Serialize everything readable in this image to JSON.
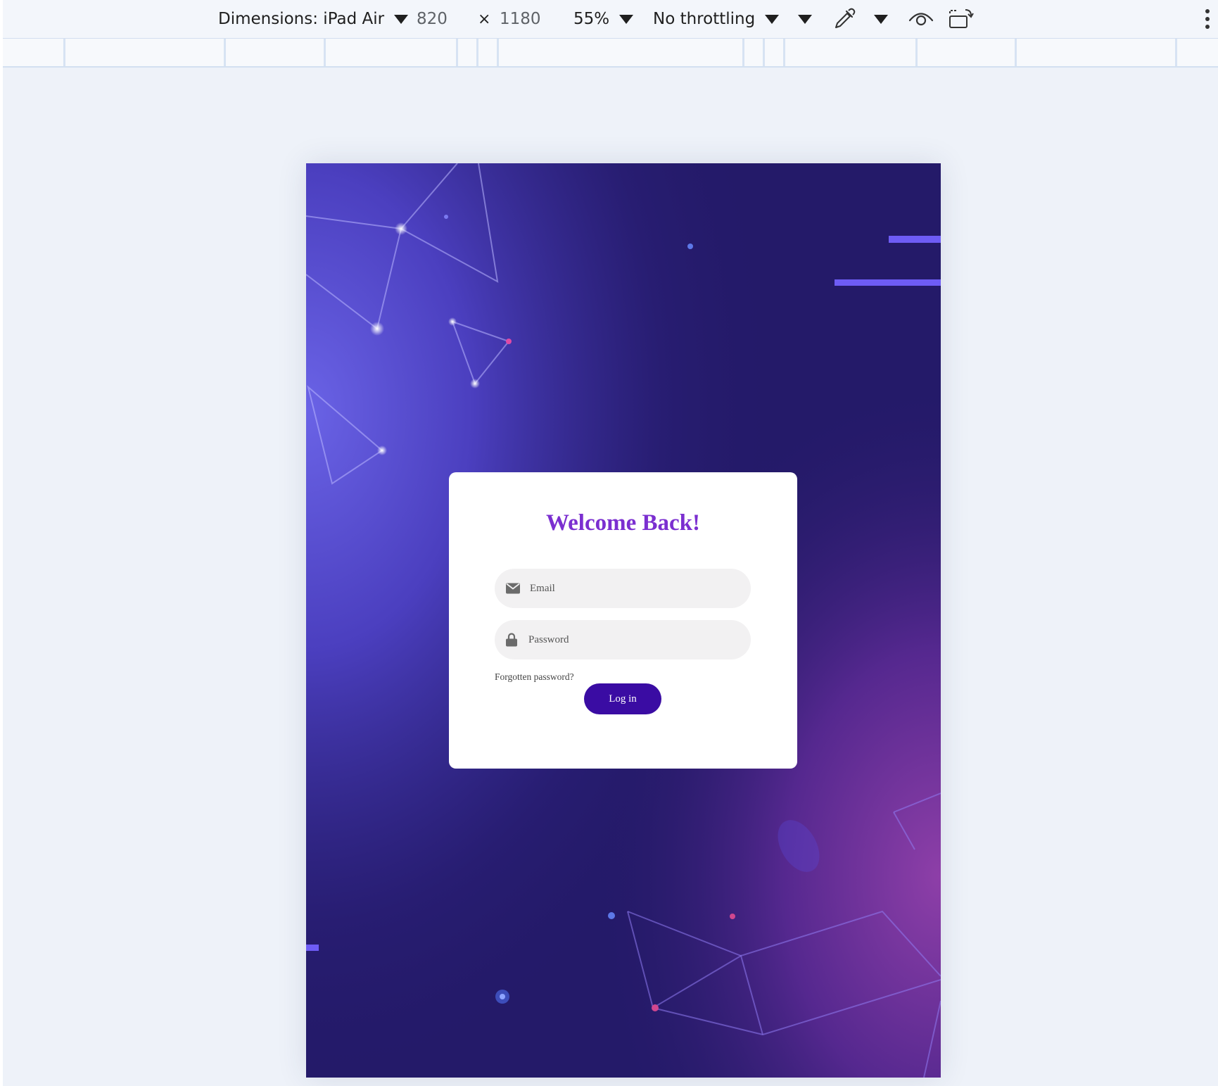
{
  "toolbar": {
    "dimensions_label": "Dimensions: iPad Air",
    "width_value": "820",
    "times_symbol": "×",
    "height_value": "1180",
    "zoom_value": "55%",
    "throttling_label": "No throttling"
  },
  "icons": {
    "dimensions_caret": "chevron-down-icon",
    "zoom_caret": "chevron-down-icon",
    "throttling_caret": "chevron-down-icon",
    "extra_caret": "chevron-down-icon",
    "eyedropper": "eyedropper-icon",
    "vision_caret": "chevron-down-icon",
    "vision": "eye-icon",
    "rotate": "rotate-device-icon",
    "more": "more-vertical-icon",
    "email": "envelope-icon",
    "password": "lock-icon"
  },
  "login": {
    "title": "Welcome Back!",
    "email_placeholder": "Email",
    "password_placeholder": "Password",
    "forgot_link": "Forgotten password?",
    "login_button": "Log in"
  },
  "colors": {
    "title": "#7b2fd0",
    "button": "#3a0ca3",
    "background_dark": "#241a69",
    "background_light": "#6a63e6"
  }
}
